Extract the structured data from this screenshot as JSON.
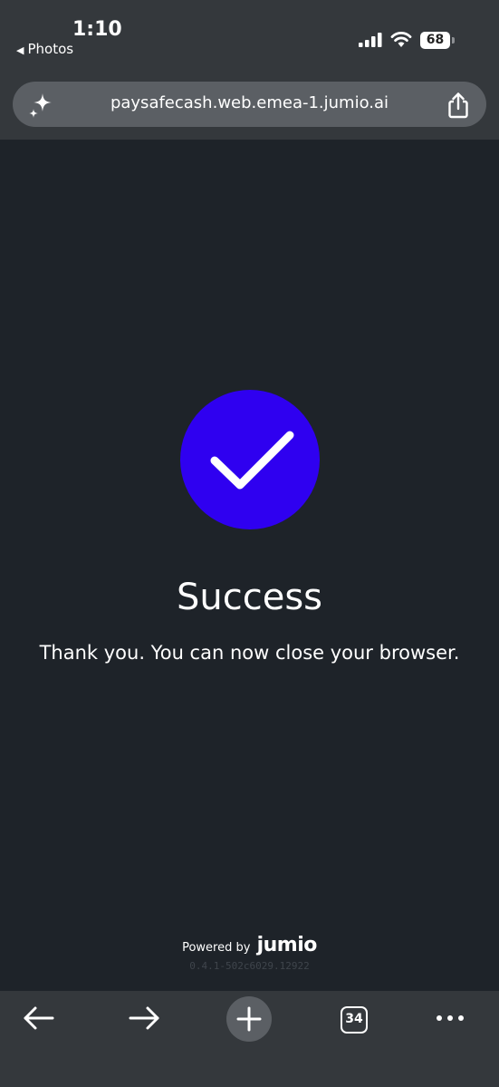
{
  "status_bar": {
    "time": "1:10",
    "back_label": "Photos",
    "battery": "68"
  },
  "browser": {
    "url": "paysafecash.web.emea-1.jumio.ai",
    "tab_count": "34"
  },
  "content": {
    "title": "Success",
    "message": "Thank you. You can now close your browser.",
    "accent_color": "#2f00f0"
  },
  "footer": {
    "powered_by": "Powered by",
    "brand": "jumio",
    "version": "0.4.1-502c6029.12922"
  },
  "icons": {
    "sparkle": "sparkle-icon",
    "share": "share-icon",
    "back": "arrow-left-icon",
    "forward": "arrow-right-icon",
    "new_tab": "plus-icon",
    "more": "more-icon",
    "success": "checkmark-icon"
  }
}
